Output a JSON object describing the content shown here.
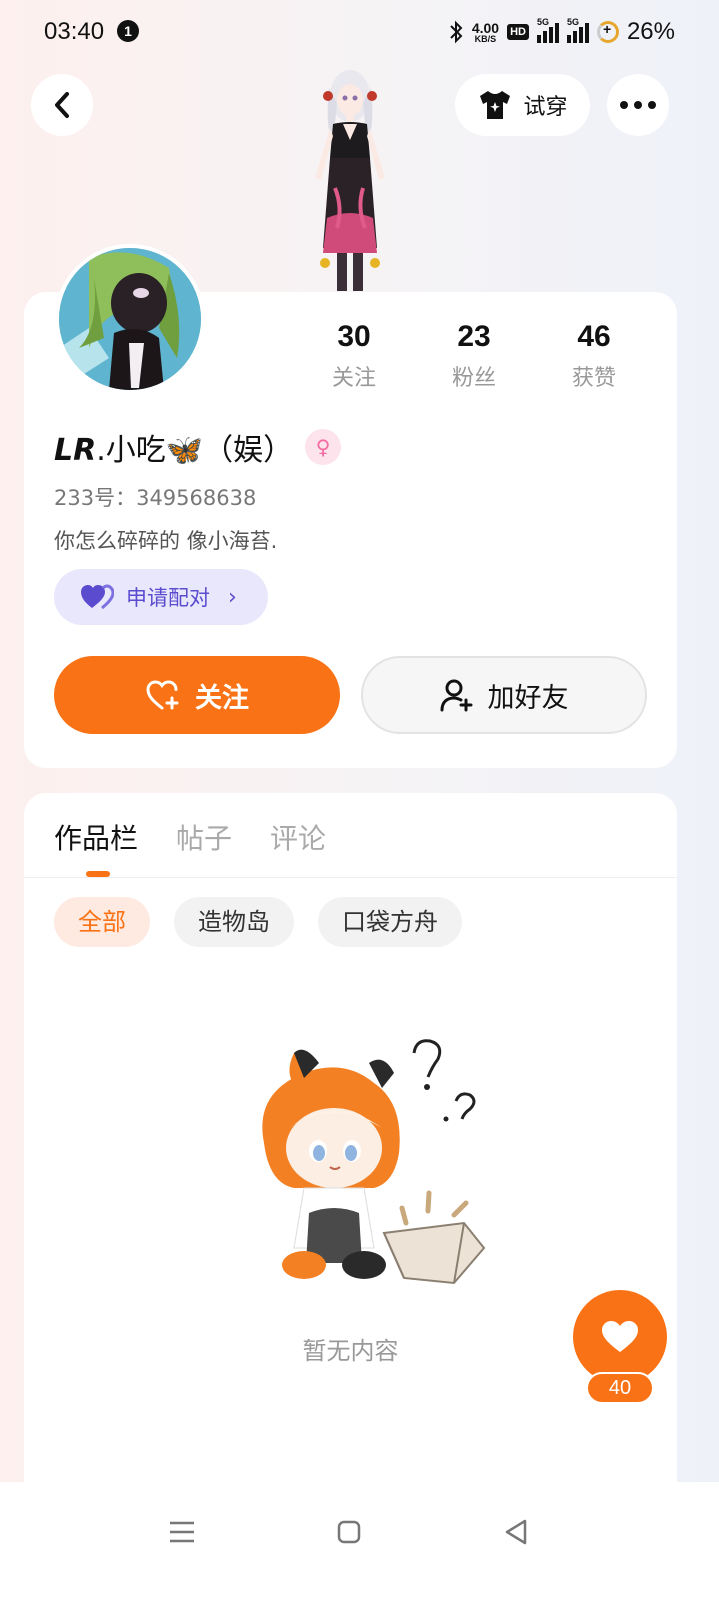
{
  "status_bar": {
    "time": "03:40",
    "notification_count": "1",
    "net_speed": "4.00",
    "net_speed_unit": "KB/S",
    "hd_label": "HD",
    "signal_label_1": "5G",
    "signal_label_2": "5G",
    "battery": "26%"
  },
  "header": {
    "try_on_label": "试穿"
  },
  "profile": {
    "stats": [
      {
        "value": "30",
        "label": "关注"
      },
      {
        "value": "23",
        "label": "粉丝"
      },
      {
        "value": "46",
        "label": "获赞"
      }
    ],
    "name_prefix": "LR",
    "name_rest": ".小吃🦋（娱）",
    "gender_symbol": "♀",
    "id_text": "233号：349568638",
    "bio": "你怎么碎碎的  像小海苔.",
    "match_label": "申请配对",
    "follow_label": "关注",
    "add_friend_label": "加好友"
  },
  "content": {
    "tabs": [
      {
        "label": "作品栏",
        "active": true
      },
      {
        "label": "帖子",
        "active": false
      },
      {
        "label": "评论",
        "active": false
      }
    ],
    "chips": [
      {
        "label": "全部",
        "active": true
      },
      {
        "label": "造物岛",
        "active": false
      },
      {
        "label": "口袋方舟",
        "active": false
      }
    ],
    "empty_text": "暂无内容"
  },
  "like": {
    "count": "40"
  },
  "colors": {
    "accent": "#f97316",
    "match_purple": "#5b4ccf",
    "gender_pink": "#f56aa0"
  }
}
